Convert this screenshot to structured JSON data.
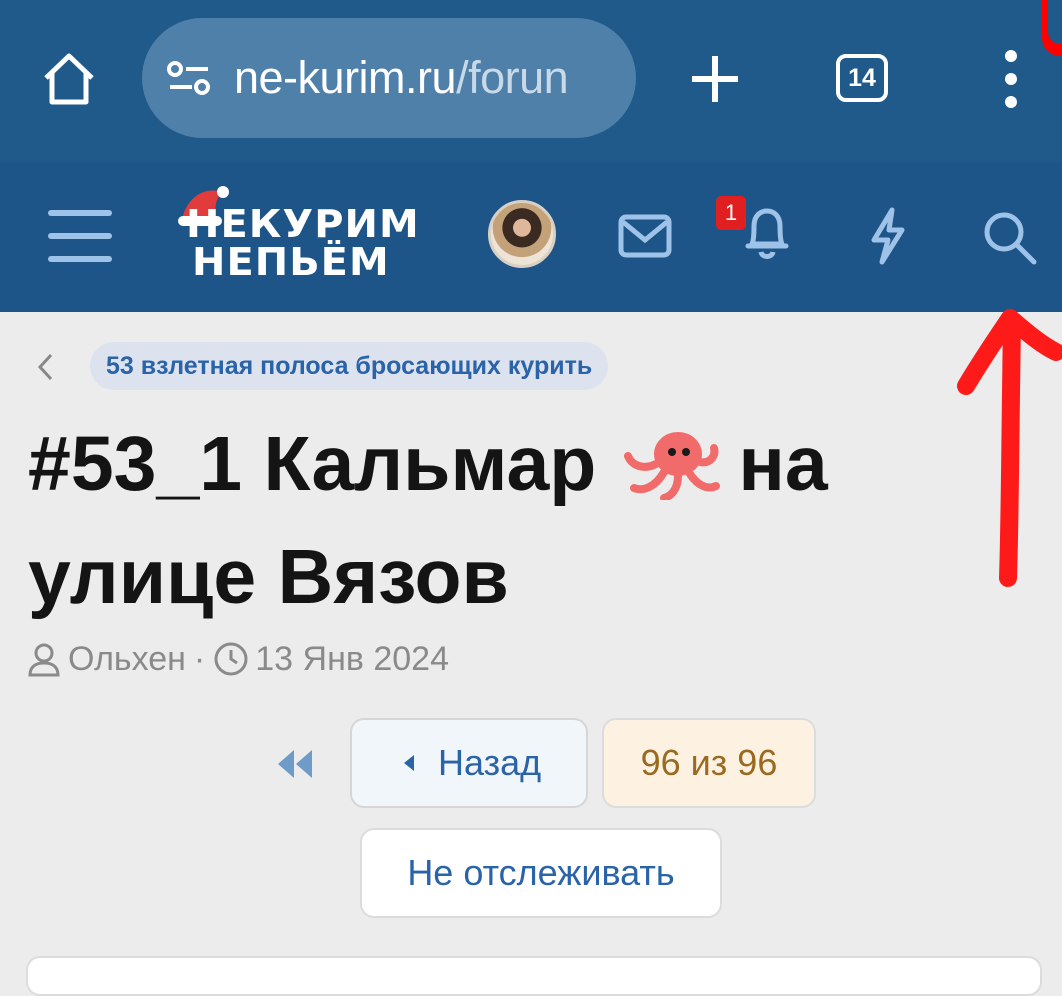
{
  "browser": {
    "url_domain": "ne-kurim.ru",
    "url_path": "/forun",
    "tab_count": "14",
    "icons": [
      "home-icon",
      "site-settings-icon",
      "new-tab-icon",
      "tabs-icon",
      "more-vert-icon"
    ]
  },
  "site_header": {
    "logo_line1": "НЕКУРИМ",
    "logo_line2": "НЕПЬЁМ",
    "notification_count": "1",
    "icons": [
      "menu-icon",
      "avatar",
      "mail-icon",
      "bell-icon",
      "lightning-icon",
      "search-icon"
    ],
    "colors": {
      "header_bg": "#1e5588",
      "badge": "#e02020"
    }
  },
  "breadcrumb": {
    "label": "53 взлетная полоса бросающих курить"
  },
  "thread": {
    "title_part1": "#53_1 Кальмар",
    "title_part2": "на улице Вязов",
    "author": "Ольхен",
    "separator": "·",
    "date": "13 Янв 2024"
  },
  "pagination": {
    "back_label": "Назад",
    "page_label": "96 из 96"
  },
  "actions": {
    "unwatch_label": "Не отслеживать"
  },
  "annotation": {
    "color": "#ff1a1a"
  }
}
